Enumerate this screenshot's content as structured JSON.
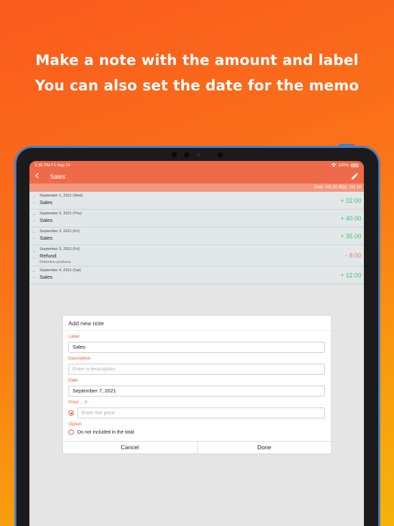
{
  "promo": {
    "line1": "Make a note with the amount and label",
    "line2": "You can also set the date for the memo"
  },
  "status": {
    "time": "5:35 PM  Fri Sep 24",
    "battery": "100%"
  },
  "nav": {
    "back_icon": "chevron-left-icon",
    "title": "Sales",
    "edit_icon": "pencil-icon"
  },
  "total": "Total: 101.00  税込: 111.10",
  "rows": [
    {
      "date": "September 1, 2021 (Wed)",
      "label": "Sales",
      "desc": "",
      "amount": "+ 22.00",
      "sign": "pos"
    },
    {
      "date": "September 2, 2021 (Thu)",
      "label": "Sales",
      "desc": "",
      "amount": "+ 40.00",
      "sign": "pos"
    },
    {
      "date": "September 3, 2021 (Fri)",
      "label": "Sales",
      "desc": "",
      "amount": "+ 35.00",
      "sign": "pos"
    },
    {
      "date": "September 3, 2021 (Fri)",
      "label": "Refund",
      "desc": "Defective products",
      "amount": "- 8.00",
      "sign": "neg"
    },
    {
      "date": "September 4, 2021 (Sat)",
      "label": "Sales",
      "desc": "",
      "amount": "+ 12.00",
      "sign": "pos"
    }
  ],
  "dialog": {
    "title": "Add new note",
    "label_caption": "Label",
    "label_value": "Sales",
    "description_caption": "Description",
    "description_placeholder": "Enter a description",
    "date_caption": "Date",
    "date_value": "September 7, 2021",
    "price_caption": "Price ... 0",
    "price_placeholder": "Enter the price",
    "option_caption": "Option",
    "option_label": "Do not included in the total",
    "cancel": "Cancel",
    "done": "Done"
  },
  "colors": {
    "accent": "#ef6a48",
    "positive": "#42c06e",
    "negative": "#ee7f68",
    "caption": "#e0612c"
  }
}
